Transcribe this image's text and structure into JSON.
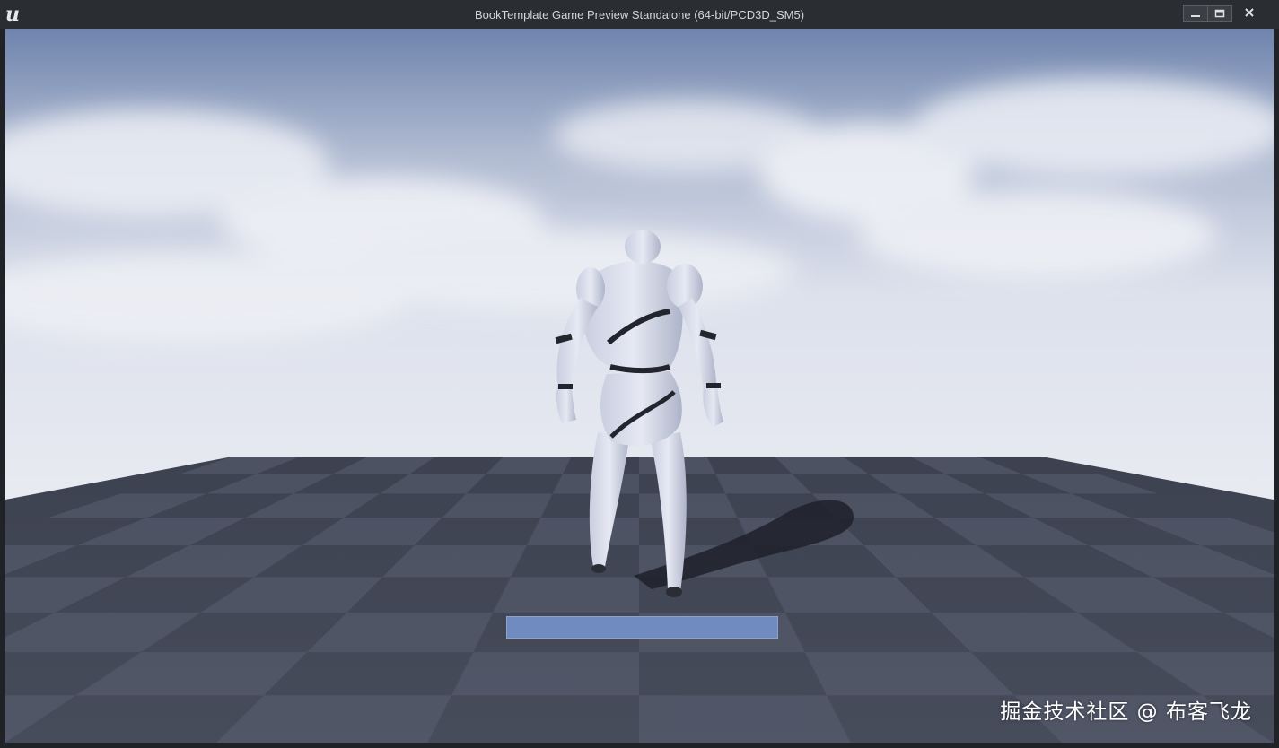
{
  "window": {
    "title": "BookTemplate Game Preview Standalone (64-bit/PCD3D_SM5)",
    "logo_icon": "unreal-engine-logo",
    "controls": [
      "minimize-icon",
      "maximize-icon",
      "close-icon"
    ]
  },
  "viewport": {
    "scene": "third-person-mannequin-on-checkered-floor",
    "hud_bar_color": "#6f8bbf"
  },
  "watermark": "掘金技术社区 @ 布客飞龙"
}
